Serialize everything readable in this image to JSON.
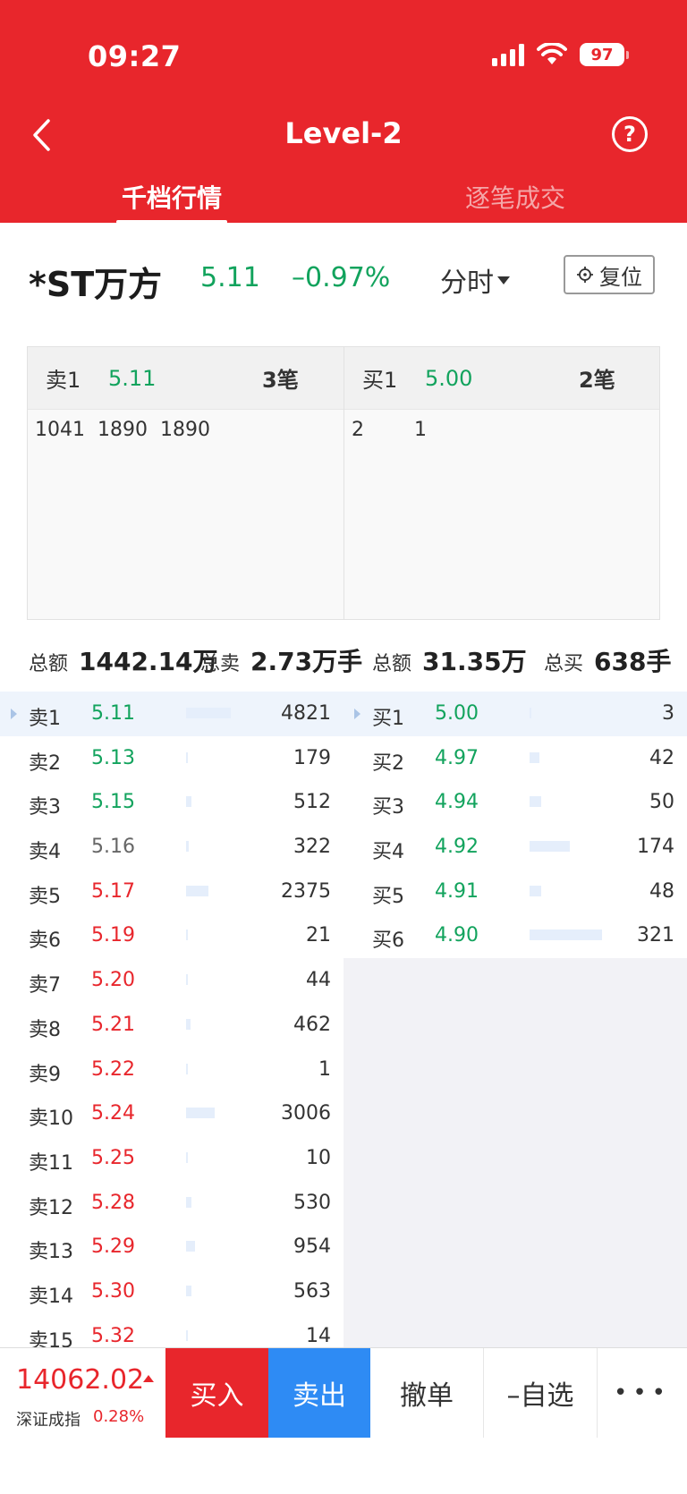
{
  "status_bar": {
    "time": "09:27",
    "battery": "97"
  },
  "header": {
    "title": "Level-2",
    "help": "?"
  },
  "tabs": [
    {
      "label": "千档行情",
      "active": true
    },
    {
      "label": "逐笔成交",
      "active": false
    }
  ],
  "stock": {
    "name": "*ST万方",
    "price": "5.11",
    "change_pct": "–0.97%",
    "timeframe": "分时",
    "reset_label": "复位"
  },
  "level2": {
    "sell": {
      "label": "卖1",
      "price": "5.11",
      "count": "3笔",
      "orders": [
        "1041",
        "1890",
        "1890"
      ]
    },
    "buy": {
      "label": "买1",
      "price": "5.00",
      "count": "2笔",
      "orders": [
        "2",
        "1"
      ]
    }
  },
  "totals": {
    "sell_amount_label": "总额",
    "sell_amount": "1442.14万",
    "sell_total_label": "总卖",
    "sell_total": "2.73万手",
    "buy_amount_label": "总额",
    "buy_amount": "31.35万",
    "buy_total_label": "总买",
    "buy_total": "638手"
  },
  "order_book": {
    "sell": [
      {
        "label": "卖1",
        "price": "5.11",
        "volume": "4821",
        "color": "#12a35d",
        "fill": 0.36
      },
      {
        "label": "卖2",
        "price": "5.13",
        "volume": "179",
        "color": "#12a35d",
        "fill": 0.01
      },
      {
        "label": "卖3",
        "price": "5.15",
        "volume": "512",
        "color": "#12a35d",
        "fill": 0.04
      },
      {
        "label": "卖4",
        "price": "5.16",
        "volume": "322",
        "color": "#666666",
        "fill": 0.02
      },
      {
        "label": "卖5",
        "price": "5.17",
        "volume": "2375",
        "color": "#e8262c",
        "fill": 0.18
      },
      {
        "label": "卖6",
        "price": "5.19",
        "volume": "21",
        "color": "#e8262c",
        "fill": 0.005
      },
      {
        "label": "卖7",
        "price": "5.20",
        "volume": "44",
        "color": "#e8262c",
        "fill": 0.005
      },
      {
        "label": "卖8",
        "price": "5.21",
        "volume": "462",
        "color": "#e8262c",
        "fill": 0.035
      },
      {
        "label": "卖9",
        "price": "5.22",
        "volume": "1",
        "color": "#e8262c",
        "fill": 0.005
      },
      {
        "label": "卖10",
        "price": "5.24",
        "volume": "3006",
        "color": "#e8262c",
        "fill": 0.23
      },
      {
        "label": "卖11",
        "price": "5.25",
        "volume": "10",
        "color": "#e8262c",
        "fill": 0.005
      },
      {
        "label": "卖12",
        "price": "5.28",
        "volume": "530",
        "color": "#e8262c",
        "fill": 0.04
      },
      {
        "label": "卖13",
        "price": "5.29",
        "volume": "954",
        "color": "#e8262c",
        "fill": 0.07
      },
      {
        "label": "卖14",
        "price": "5.30",
        "volume": "563",
        "color": "#e8262c",
        "fill": 0.04
      },
      {
        "label": "卖15",
        "price": "5.32",
        "volume": "14",
        "color": "#e8262c",
        "fill": 0.005
      }
    ],
    "buy": [
      {
        "label": "买1",
        "price": "5.00",
        "volume": "3",
        "color": "#12a35d",
        "fill": 0.01
      },
      {
        "label": "买2",
        "price": "4.97",
        "volume": "42",
        "color": "#12a35d",
        "fill": 0.08
      },
      {
        "label": "买3",
        "price": "4.94",
        "volume": "50",
        "color": "#12a35d",
        "fill": 0.09
      },
      {
        "label": "买4",
        "price": "4.92",
        "volume": "174",
        "color": "#12a35d",
        "fill": 0.32
      },
      {
        "label": "买5",
        "price": "4.91",
        "volume": "48",
        "color": "#12a35d",
        "fill": 0.09
      },
      {
        "label": "买6",
        "price": "4.90",
        "volume": "321",
        "color": "#12a35d",
        "fill": 0.58
      }
    ]
  },
  "bottom": {
    "index_value": "14062.02",
    "index_name": "深证成指",
    "index_pct": "0.28%",
    "buy": "买入",
    "sell": "卖出",
    "cancel": "撤单",
    "watchlist": "–自选",
    "more": "•••"
  }
}
